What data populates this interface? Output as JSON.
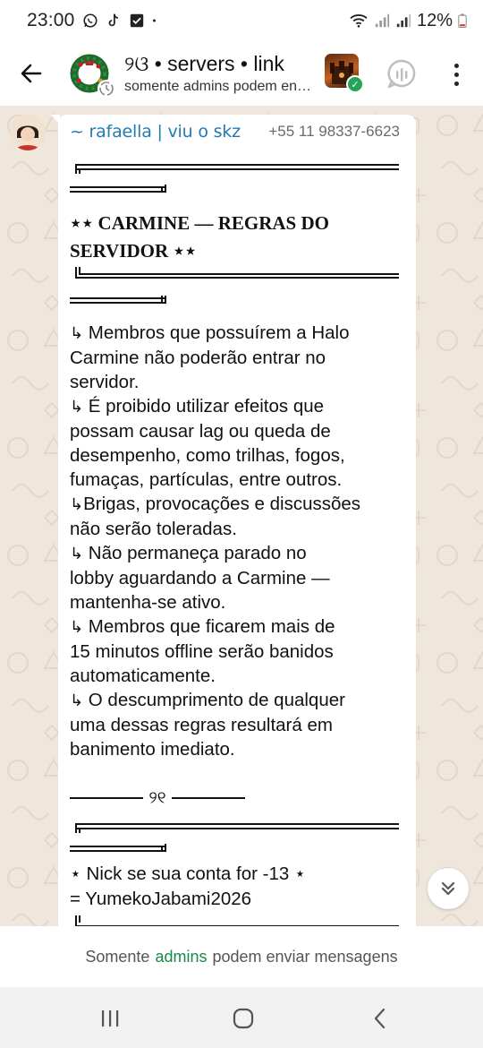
{
  "status_bar": {
    "time": "23:00",
    "battery": "12%"
  },
  "header": {
    "group_name": "୨ଓ • servers • link",
    "subtitle": "somente admins podem enviar mensagens"
  },
  "message": {
    "sender_name": "~ rafaella | viu o skz",
    "sender_phone": "+55 11 98337-6623",
    "title_line1": "⋆⋆ CARMINE — REGRAS DO",
    "title_line2": "SERVIDOR ⋆⋆",
    "rules": [
      " Membros que possuírem a Halo\nCarmine não poderão entrar no\nservidor.",
      " É proibido utilizar efeitos que\npossam causar lag ou queda de\ndesempenho, como trilhas, fogos,\nfumaças, partículas, entre outros.",
      "Brigas, provocações e discussões\nnão serão toleradas.",
      " Não permaneça parado no\nlobby aguardando a Carmine —\nmantenha-se ativo.",
      " Membros que ficarem mais de\n15 minutos offline serão banidos\nautomaticamente.",
      " O descumprimento de qualquer\numa dessas regras resultará em\nbanimento imediato."
    ],
    "rule_arrow": "↳",
    "divider_symbol": "୨୧",
    "nick_line1": "⋆ Nick se sua conta for -13 ⋆",
    "nick_line2": "= YumekoJabami2026"
  },
  "footer": {
    "prefix": "Somente",
    "link": "admins",
    "suffix": "podem enviar mensagens"
  },
  "icons": {
    "back": "arrow-left-icon",
    "call": "group-call-icon",
    "menu": "more-vert-icon",
    "scroll": "double-chevron-down-icon",
    "nav_recent": "recent-apps-icon",
    "nav_home": "home-icon",
    "nav_back": "nav-back-icon"
  },
  "colors": {
    "accent_green": "#1a8a4a",
    "sender_blue": "#1f7bb4",
    "wallpaper": "#efe7dc"
  }
}
